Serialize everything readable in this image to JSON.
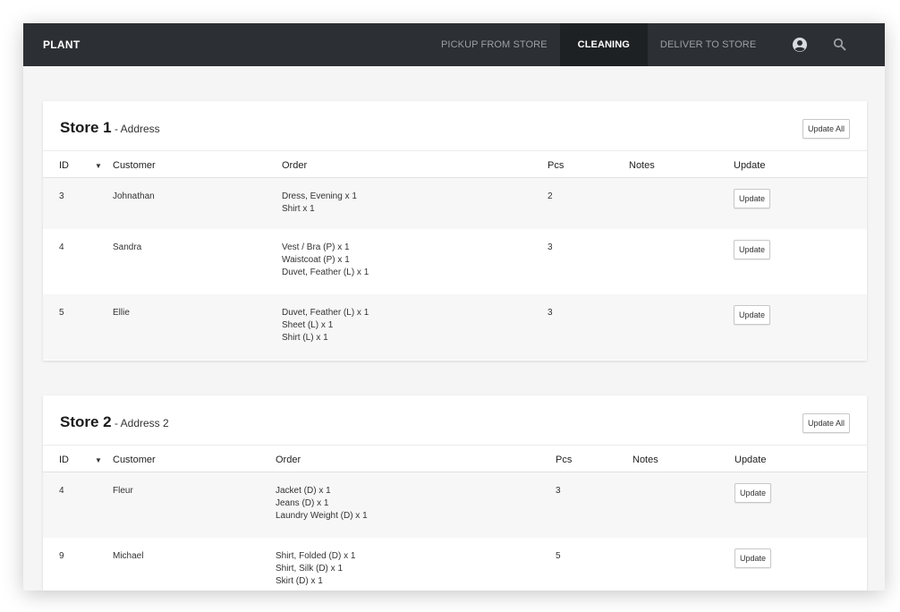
{
  "nav": {
    "brand": "PLANT",
    "links": [
      "PICKUP FROM STORE",
      "CLEANING",
      "DELIVER TO STORE"
    ],
    "active_index": 1,
    "icons": [
      "account-icon",
      "search-icon"
    ]
  },
  "columns": {
    "id": "ID",
    "customer": "Customer",
    "order": "Order",
    "pcs": "Pcs",
    "notes": "Notes",
    "update": "Update"
  },
  "stores": [
    {
      "title": "Store 1",
      "address": " - Address",
      "update_all": "Update All",
      "rows": [
        {
          "id": "3",
          "customer": "Johnathan",
          "order": [
            "Dress, Evening x 1",
            "Shirt x 1"
          ],
          "pcs": "2",
          "notes": "",
          "update": "Update"
        },
        {
          "id": "4",
          "customer": "Sandra",
          "order": [
            "Vest / Bra (P) x 1",
            "Waistcoat (P) x 1",
            "Duvet, Feather (L) x 1"
          ],
          "pcs": "3",
          "notes": "",
          "update": "Update"
        },
        {
          "id": "5",
          "customer": "Ellie",
          "order": [
            "Duvet, Feather (L) x 1",
            "Sheet (L) x 1",
            "Shirt (L) x 1"
          ],
          "pcs": "3",
          "notes": "",
          "update": "Update"
        }
      ]
    },
    {
      "title": "Store 2",
      "address": " - Address 2",
      "update_all": "Update All",
      "rows": [
        {
          "id": "4",
          "customer": "Fleur",
          "order": [
            "Jacket (D) x 1",
            "Jeans (D) x 1",
            "Laundry Weight (D) x 1"
          ],
          "pcs": "3",
          "notes": "",
          "update": "Update"
        },
        {
          "id": "9",
          "customer": "Michael",
          "order": [
            "Shirt, Folded (D) x 1",
            "Shirt, Silk (D) x 1",
            "Skirt (D) x 1"
          ],
          "pcs": "5",
          "notes": "",
          "update": "Update"
        }
      ]
    }
  ],
  "colors": {
    "navbar": "#2c2f33",
    "nav_active": "#1e2124",
    "nav_text": "#9aa0a6",
    "page_bg": "#f5f5f5",
    "row_alt": "#f7f7f7"
  }
}
